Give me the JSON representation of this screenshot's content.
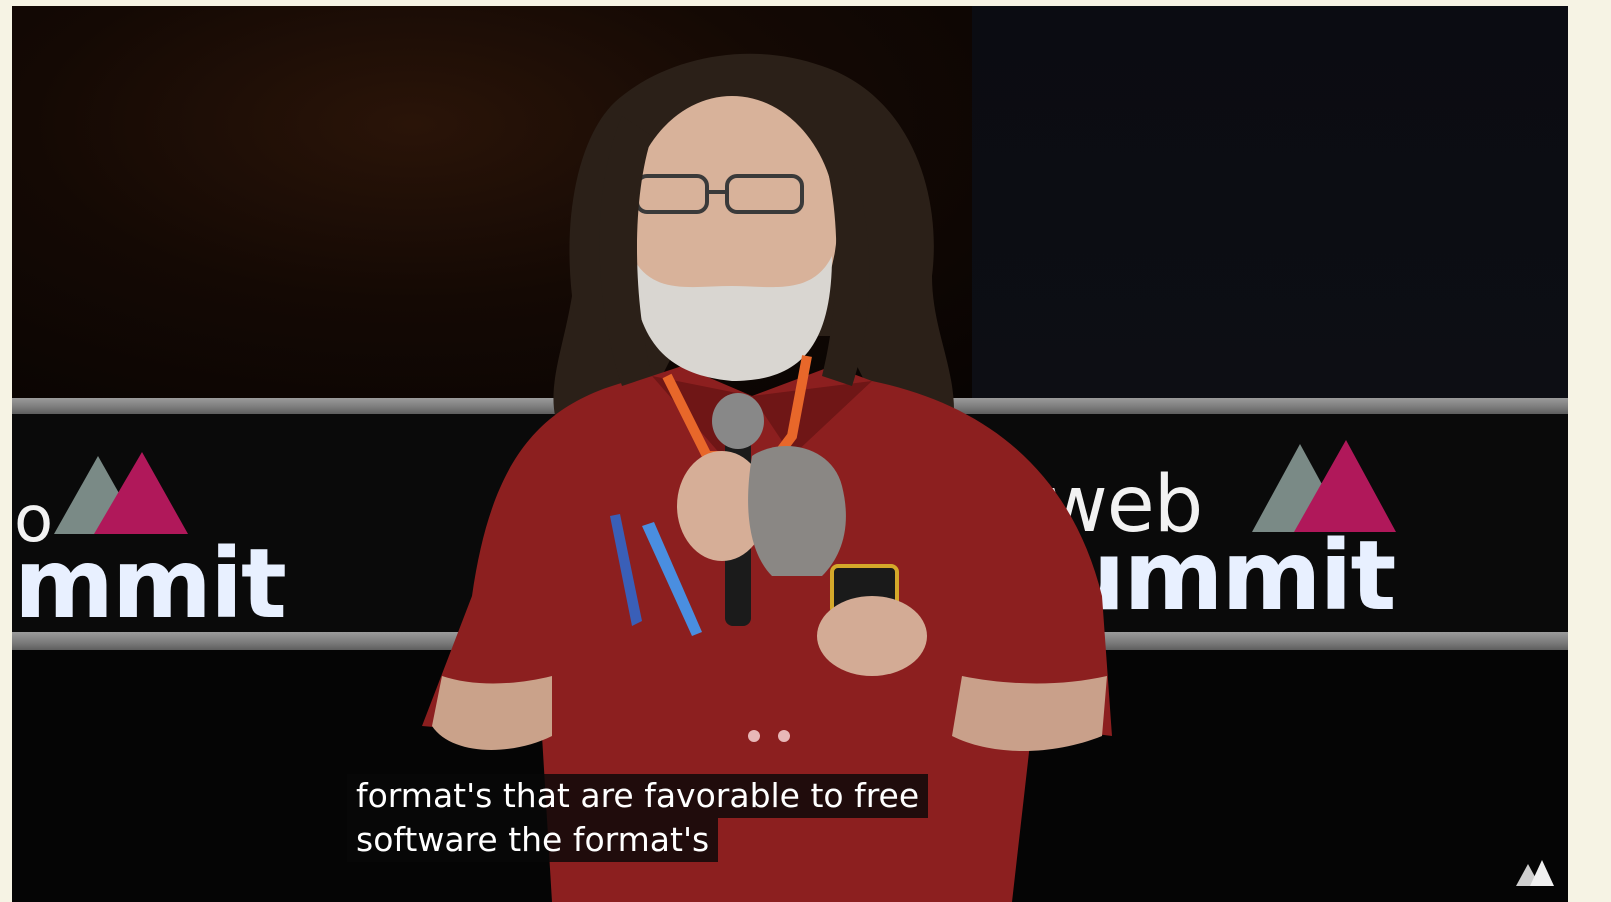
{
  "video": {
    "banner_logo_left": {
      "word_top": "o",
      "word_bottom": "mmit"
    },
    "banner_logo_right": {
      "word_top": "web",
      "word_bottom": "summit"
    },
    "subtitles": [
      "format's that are favorable to free",
      "software the format's"
    ],
    "corner_icon": "logo-watermark-icon"
  },
  "colors": {
    "logo_triangle_gray": "#7a8a86",
    "logo_triangle_magenta": "#b0185a",
    "shirt": "#8c1f1f",
    "lanyard": "#e8672a"
  }
}
